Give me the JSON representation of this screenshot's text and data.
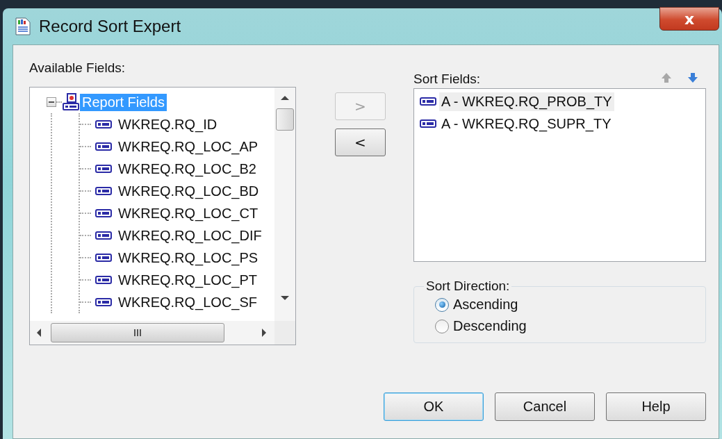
{
  "window": {
    "title": "Record Sort Expert",
    "close_label": "x"
  },
  "available_fields": {
    "label": "Available Fields:",
    "tree": {
      "label": "Report Fields",
      "expanded": true,
      "selected": true,
      "children": [
        {
          "label": "WKREQ.RQ_ID",
          "selected": false
        },
        {
          "label": "WKREQ.RQ_LOC_AP",
          "selected": false
        },
        {
          "label": "WKREQ.RQ_LOC_B2",
          "selected": false
        },
        {
          "label": "WKREQ.RQ_LOC_BD",
          "selected": false
        },
        {
          "label": "WKREQ.RQ_LOC_CT",
          "selected": false
        },
        {
          "label": "WKREQ.RQ_LOC_DIF",
          "selected": false
        },
        {
          "label": "WKREQ.RQ_LOC_PS",
          "selected": false
        },
        {
          "label": "WKREQ.RQ_LOC_PT",
          "selected": false
        },
        {
          "label": "WKREQ.RQ_LOC_SF",
          "selected": false
        }
      ]
    }
  },
  "move_buttons": [
    {
      "label": ">",
      "disabled": true
    },
    {
      "label": "<",
      "disabled": false
    }
  ],
  "sort_fields": {
    "label": "Sort Fields:",
    "move_up_disabled": true,
    "move_down_disabled": false,
    "items": [
      {
        "label": "A - WKREQ.RQ_PROB_TY",
        "selected": true
      },
      {
        "label": "A - WKREQ.RQ_SUPR_TY",
        "selected": false
      }
    ]
  },
  "sort_direction": {
    "label": "Sort Direction:",
    "options": [
      {
        "label": "Ascending",
        "selected": true
      },
      {
        "label": "Descending",
        "selected": false
      }
    ]
  },
  "buttons": [
    {
      "label": "OK",
      "default": true
    },
    {
      "label": "Cancel",
      "default": false
    },
    {
      "label": "Help",
      "default": false
    }
  ]
}
